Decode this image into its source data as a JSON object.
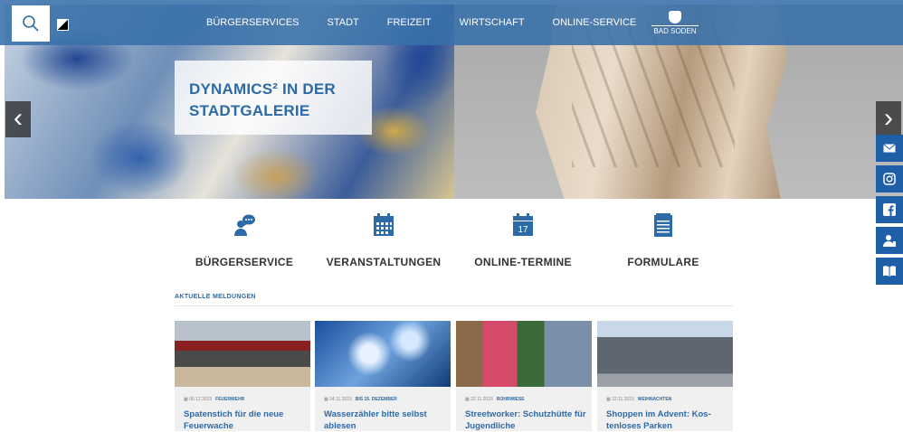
{
  "nav": {
    "items": [
      "BÜRGERSERVICES",
      "STADT",
      "FREIZEIT",
      "WIRTSCHAFT",
      "ONLINE-SERVICE"
    ],
    "logo_text": "BAD SODEN"
  },
  "hero": {
    "caption": "DYNAMICS² IN DER STADTGALERIE"
  },
  "services": [
    {
      "label": "BÜRGERSERVICE",
      "icon": "chat-person-icon"
    },
    {
      "label": "VERANSTALTUNGEN",
      "icon": "calendar-grid-icon"
    },
    {
      "label": "ONLINE-TERMINE",
      "icon": "calendar-17-icon",
      "day": "17"
    },
    {
      "label": "FORMULARE",
      "icon": "form-list-icon"
    }
  ],
  "news": {
    "heading": "AKTUELLE MELDUNGEN",
    "items": [
      {
        "date": "06.12.2023",
        "tag": "FEUERWEHR",
        "title": "Spatenstich für die neue Feuerwache"
      },
      {
        "date": "24.11.2023",
        "tag": "BIS 15. DEZEMBER",
        "title": "Wasserzähler bitte selbst ablesen"
      },
      {
        "date": "22.11.2023",
        "tag": "ROHRWIESE",
        "title": "Streetworker: Schutzhütte für Jugendliche"
      },
      {
        "date": "22.11.2023",
        "tag": "WEIHNACHTEN",
        "title": "Shoppen im Advent: Kos­tenloses Parken"
      }
    ]
  },
  "social": [
    "mail-icon",
    "instagram-icon",
    "facebook-icon",
    "contact-person-icon",
    "book-icon"
  ],
  "colors": {
    "nav": "#3870aa",
    "accent": "#2c6aa8",
    "social": "#1f5fa8"
  }
}
